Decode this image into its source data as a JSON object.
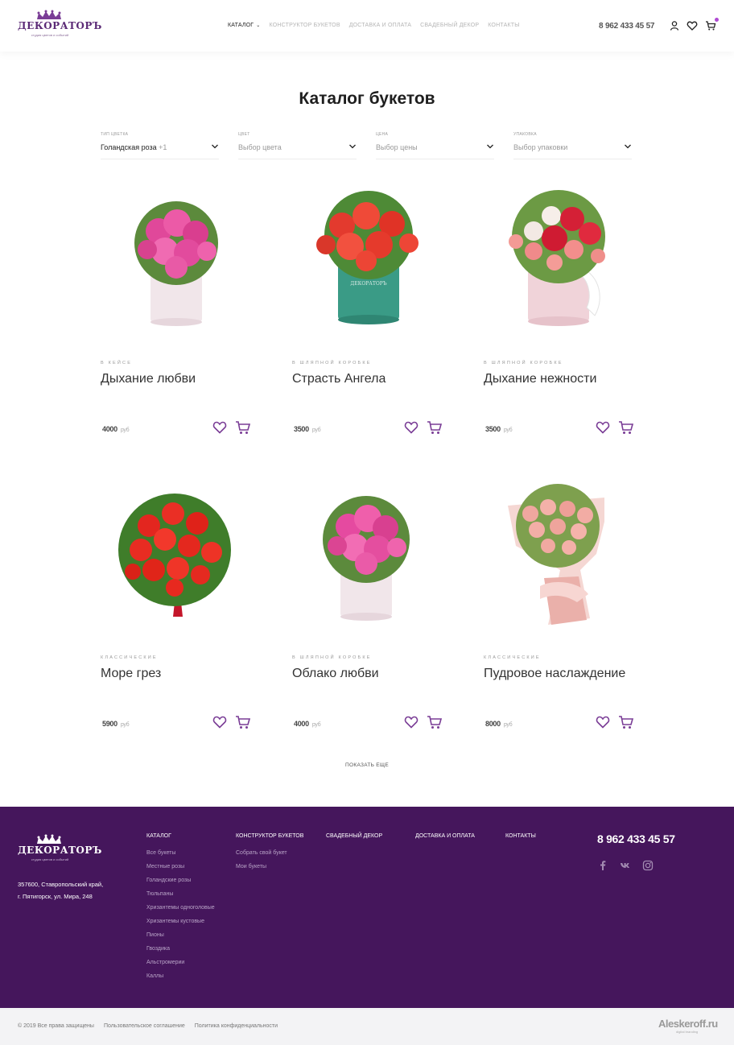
{
  "header": {
    "logo_text": "ДЕКОРАТОРЪ",
    "logo_sub": "студия цветов и событий",
    "nav": [
      {
        "label": "КАТАЛОГ",
        "active": true
      },
      {
        "label": "КОНСТРУКТОР БУКЕТОВ",
        "active": false
      },
      {
        "label": "ДОСТАВКА И ОПЛАТА",
        "active": false
      },
      {
        "label": "СВАДЕБНЫЙ ДЕКОР",
        "active": false
      },
      {
        "label": "КОНТАКТЫ",
        "active": false
      }
    ],
    "phone": "8 962 433 45 57",
    "icons": [
      "user-icon",
      "heart-icon",
      "cart-icon"
    ],
    "accent": "#b04ad3"
  },
  "main": {
    "title": "Каталог букетов",
    "filters": [
      {
        "label": "ТИП ЦВЕТКА",
        "value": "Голандская роза",
        "extra": "+1",
        "set": true
      },
      {
        "label": "ЦВЕТ",
        "value": "Выбор цвета",
        "extra": "",
        "set": false
      },
      {
        "label": "ЦЕНА",
        "value": "Выбор цены",
        "extra": "",
        "set": false
      },
      {
        "label": "УПАКОВКА",
        "value": "Выбор упаковки",
        "extra": "",
        "set": false
      }
    ],
    "products": [
      {
        "category": "В КЕЙСЕ",
        "name": "Дыхание любви",
        "price": "4000",
        "currency": "руб"
      },
      {
        "category": "В ШЛЯПНОЙ КОРОБКЕ",
        "name": "Страсть Ангела",
        "price": "3500",
        "currency": "руб"
      },
      {
        "category": "В ШЛЯПНОЙ КОРОБКЕ",
        "name": "Дыхание нежности",
        "price": "3500",
        "currency": "руб"
      },
      {
        "category": "КЛАССИЧЕСКИЕ",
        "name": "Море грез",
        "price": "5900",
        "currency": "руб"
      },
      {
        "category": "В ШЛЯПНОЙ КОРОБКЕ",
        "name": "Облако любви",
        "price": "4000",
        "currency": "руб"
      },
      {
        "category": "КЛАССИЧЕСКИЕ",
        "name": "Пудровое наслаждение",
        "price": "8000",
        "currency": "руб"
      }
    ],
    "show_more": "ПОКАЗАТЬ ЕЩЕ"
  },
  "footer": {
    "logo_text": "ДЕКОРАТОРЪ",
    "logo_sub": "студия цветов и событий",
    "address_line1": "357600, Ставропольский край,",
    "address_line2": "г. Пятигорск, ул. Мира, 248",
    "columns": [
      {
        "title": "КАТАЛОГ",
        "links": [
          "Все букеты",
          "Местные розы",
          "Голандские розы",
          "Тюльпаны",
          "Хризантемы одноголовые",
          "Хризантемы кустовые",
          "Пионы",
          "Гвоздика",
          "Альстромерии",
          "Каллы"
        ]
      },
      {
        "title": "КОНСТРУКТОР БУКЕТОВ",
        "links": [
          "Собрать свой букет",
          "Мои букеты"
        ]
      },
      {
        "title": "СВАДЕБНЫЙ ДЕКОР",
        "links": []
      },
      {
        "title": "ДОСТАВКА И ОПЛАТА",
        "links": []
      },
      {
        "title": "КОНТАКТЫ",
        "links": []
      }
    ],
    "phone": "8 962 433 45 57",
    "social": [
      "facebook-icon",
      "vk-icon",
      "instagram-icon"
    ],
    "background": "#45165c"
  },
  "bottom": {
    "copyright": "© 2019 Все права защищены",
    "links": [
      "Пользовательское соглашение",
      "Политика конфиденциальности"
    ],
    "developer": "Aleskeroff.ru",
    "developer_sub": "digital branding"
  }
}
